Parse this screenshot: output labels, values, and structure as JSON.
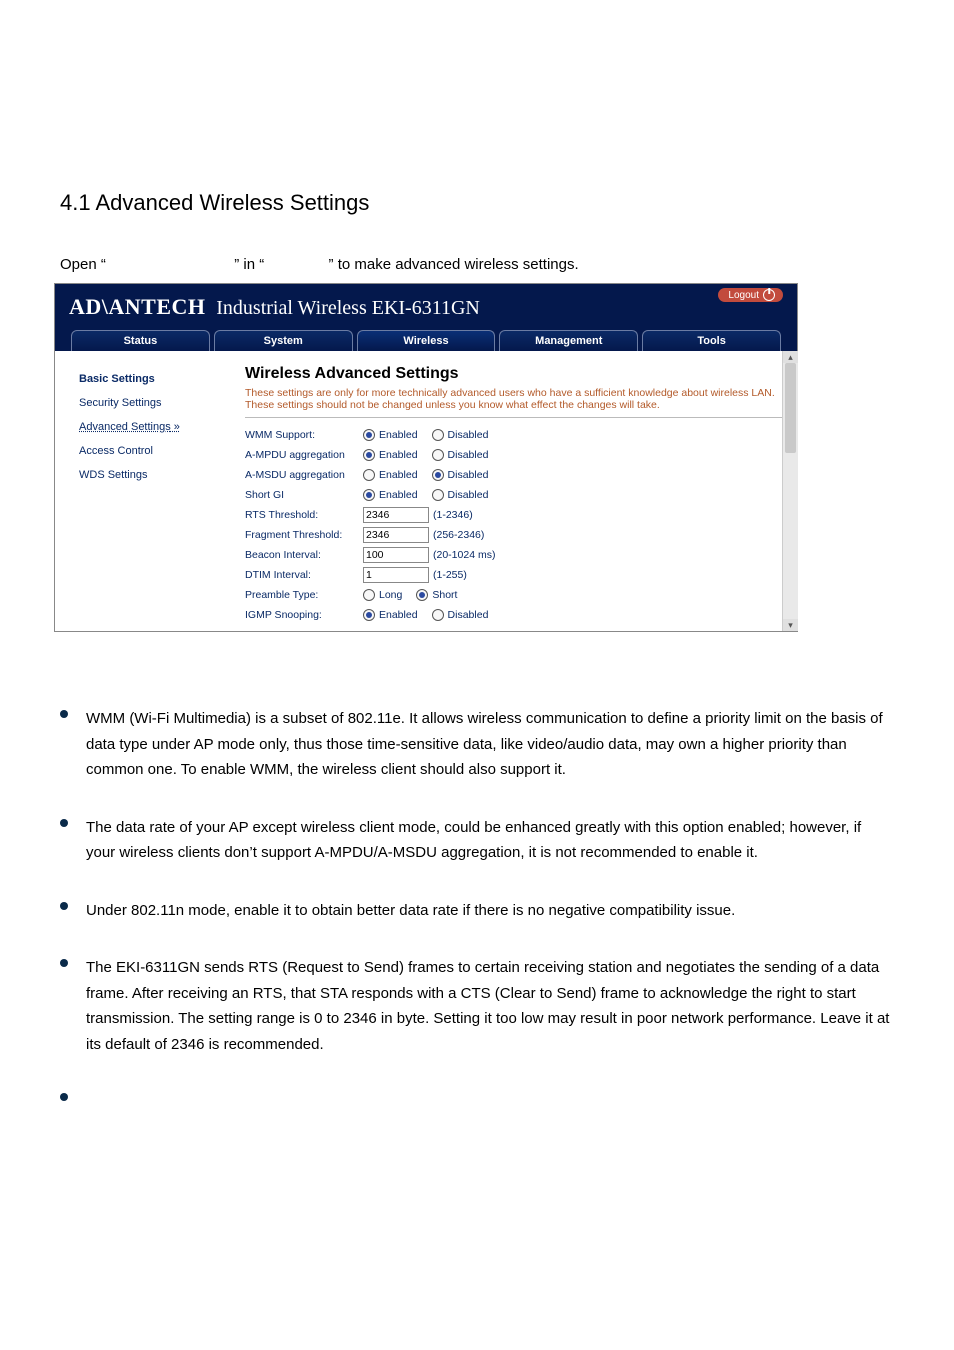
{
  "doc": {
    "heading": "4.1  Advanced Wireless Settings",
    "intro_prefix": "Open “",
    "intro_mid": "” in “",
    "intro_suffix": "” to make advanced wireless settings."
  },
  "bullets": {
    "b1": "WMM (Wi-Fi Multimedia) is a subset of 802.11e. It allows wireless communication to define a priority limit on the basis of data type under AP mode only, thus those time-sensitive data, like video/audio data, may own a higher priority than common one.  To enable WMM, the wireless client should also support it.",
    "b2": "The data rate of your AP except wireless client mode, could be enhanced greatly with this option enabled; however, if your wireless clients don’t support A-MPDU/A-MSDU aggregation, it is not recommended to enable it.",
    "b3": "Under 802.11n mode, enable it to obtain better data rate if there is no negative compatibility issue.",
    "b4": "The EKI-6311GN sends RTS (Request to Send) frames to certain receiving station and negotiates the sending of a data frame. After receiving an RTS, that STA responds with a CTS (Clear to Send) frame to acknowledge the right to start transmission. The setting range is 0 to 2346 in byte.  Setting it too low may result in poor network performance. Leave it at its default of 2346 is recommended."
  },
  "shot": {
    "brand_bold": "AD\\ANTECH",
    "brand_light": "Industrial Wireless EKI-6311GN",
    "logout": "Logout",
    "tabs": {
      "status": "Status",
      "system": "System",
      "wireless": "Wireless",
      "management": "Management",
      "tools": "Tools"
    },
    "sidebar": {
      "basic": "Basic Settings",
      "security": "Security Settings",
      "advanced": "Advanced Settings",
      "access": "Access Control",
      "wds": "WDS Settings"
    },
    "panel": {
      "title": "Wireless Advanced Settings",
      "note": "These settings are only for more technically advanced users who have a sufficient knowledge about wireless LAN. These settings should not be changed unless you know what effect the changes will take.",
      "rows": {
        "wmm": {
          "label": "WMM Support:",
          "optA": "Enabled",
          "optB": "Disabled"
        },
        "ampdu": {
          "label": "A-MPDU aggregation",
          "optA": "Enabled",
          "optB": "Disabled"
        },
        "amsdu": {
          "label": "A-MSDU aggregation",
          "optA": "Enabled",
          "optB": "Disabled"
        },
        "shortgi": {
          "label": "Short GI",
          "optA": "Enabled",
          "optB": "Disabled"
        },
        "rts": {
          "label": "RTS Threshold:",
          "value": "2346",
          "hint": "(1-2346)"
        },
        "frag": {
          "label": "Fragment Threshold:",
          "value": "2346",
          "hint": "(256-2346)"
        },
        "beacon": {
          "label": "Beacon Interval:",
          "value": "100",
          "hint": "(20-1024 ms)"
        },
        "dtim": {
          "label": "DTIM Interval:",
          "value": "1",
          "hint": "(1-255)"
        },
        "preamble": {
          "label": "Preamble Type:",
          "optA": "Long",
          "optB": "Short"
        },
        "igmp": {
          "label": "IGMP Snooping:",
          "optA": "Enabled",
          "optB": "Disabled"
        }
      }
    }
  }
}
